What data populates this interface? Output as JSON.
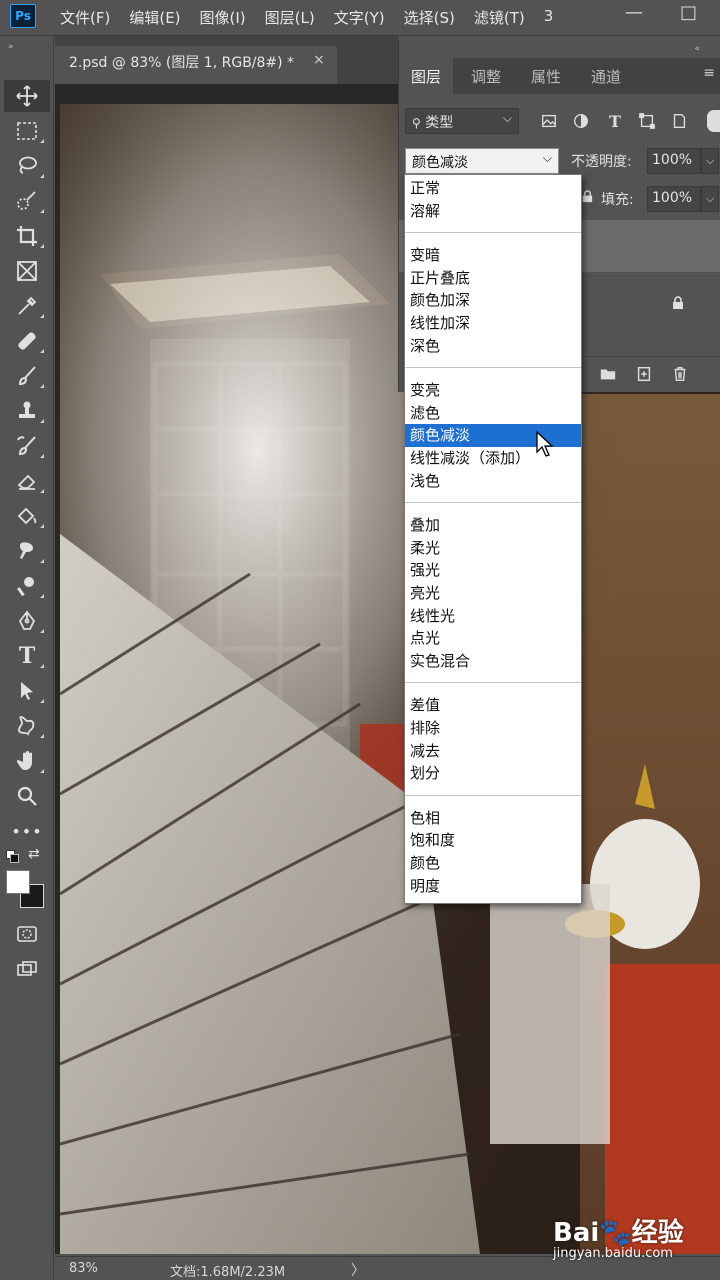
{
  "app": {
    "logo": "Ps"
  },
  "menu": [
    "文件(F)",
    "编辑(E)",
    "图像(I)",
    "图层(L)",
    "文字(Y)",
    "选择(S)",
    "滤镜(T)",
    "3"
  ],
  "window_controls": {
    "minimize": "—",
    "maximize": "□"
  },
  "document": {
    "tab_title": "2.psd @ 83% (图层 1, RGB/8#) *",
    "close": "×"
  },
  "statusbar": {
    "zoom": "83%",
    "doc_info": "文档:1.68M/2.23M",
    "arrow": "〉"
  },
  "toolbar": {
    "collapse": "»",
    "tools": [
      "move-icon",
      "marquee-icon",
      "lasso-icon",
      "quick-select-icon",
      "crop-icon",
      "frame-icon",
      "eyedropper-icon",
      "healing-brush-icon",
      "brush-icon",
      "clone-stamp-icon",
      "history-brush-icon",
      "eraser-icon",
      "paint-bucket-icon",
      "smudge-icon",
      "dodge-icon",
      "pen-icon",
      "type-icon",
      "path-select-icon",
      "custom-shape-icon",
      "hand-icon",
      "zoom-icon",
      "more-tools-icon",
      "swap-colors-icon",
      "color-swatch-icon",
      "quick-mask-icon",
      "screen-mode-icon"
    ],
    "type_tool_label": "T",
    "more_tools_label": "•••",
    "foreground_color": "#ffffff",
    "background_color": "#1a1a1a"
  },
  "panel": {
    "collapse": "«",
    "close": "×",
    "tabs": [
      "图层",
      "调整",
      "属性",
      "通道"
    ],
    "active_tab": "图层",
    "menu_icon": "≡",
    "filter": {
      "label": "类型",
      "arrow": "⌵"
    },
    "filter_icons": [
      "image-filter-icon",
      "adjustment-filter-icon",
      "type-filter-icon",
      "shape-filter-icon",
      "smart-object-filter-icon"
    ],
    "type_filter_label": "T",
    "blend_mode": {
      "value": "颜色减淡",
      "arrow": "⌵"
    },
    "opacity": {
      "label": "不透明度:",
      "value": "100%",
      "arrow": "⌵"
    },
    "fill": {
      "label": "填充:",
      "value": "100%",
      "arrow": "⌵"
    },
    "bottom_icons": [
      "new-group-icon",
      "new-layer-icon",
      "delete-layer-icon"
    ]
  },
  "blend_modes": {
    "groups": [
      [
        "正常",
        "溶解"
      ],
      [
        "变暗",
        "正片叠底",
        "颜色加深",
        "线性加深",
        "深色"
      ],
      [
        "变亮",
        "滤色",
        "颜色减淡",
        "线性减淡（添加）",
        "浅色"
      ],
      [
        "叠加",
        "柔光",
        "强光",
        "亮光",
        "线性光",
        "点光",
        "实色混合"
      ],
      [
        "差值",
        "排除",
        "减去",
        "划分"
      ],
      [
        "色相",
        "饱和度",
        "颜色",
        "明度"
      ]
    ],
    "selected": "颜色减淡"
  },
  "watermark": {
    "logo": "Bai🐾经验",
    "url": "jingyan.baidu.com"
  },
  "colors": {
    "ui_bg": "#535353",
    "selection": "#1e6fd2",
    "accent_blue": "#31a8ff"
  }
}
